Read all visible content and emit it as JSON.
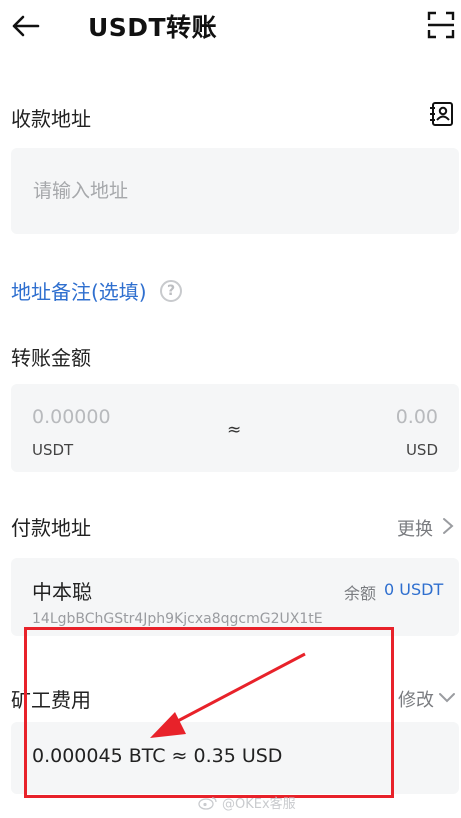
{
  "header": {
    "title": "USDT转账",
    "back_icon": "back-arrow-icon",
    "scan_icon": "scan-icon"
  },
  "recipient": {
    "label": "收款地址",
    "contacts_icon": "address-book-icon",
    "placeholder": "请输入地址",
    "value": ""
  },
  "memo": {
    "link_label": "地址备注(选填)",
    "help_icon": "help-question-icon",
    "help_glyph": "?"
  },
  "amount": {
    "label": "转账金额",
    "usdt_value": "0.00000",
    "usdt_unit": "USDT",
    "approx": "≈",
    "usd_value": "0.00",
    "usd_unit": "USD"
  },
  "payer": {
    "label": "付款地址",
    "change_label": "更换",
    "wallet_name": "中本聪",
    "balance_label": "余额",
    "balance_value": "0 USDT",
    "wallet_address": "14LgbBChGStr4Jph9Kjcxa8qgcmG2UX1tE"
  },
  "fee": {
    "label": "矿工费用",
    "edit_label": "修改",
    "value_text": "0.000045 BTC ≈ 0.35 USD"
  },
  "annotation": {
    "color": "#e8222a"
  },
  "watermark": {
    "text": "@OKEx客服",
    "icon": "weibo-icon"
  },
  "colors": {
    "accent_blue": "#2f6fcf",
    "field_bg": "#f5f6f7",
    "muted": "#7a7c80"
  }
}
